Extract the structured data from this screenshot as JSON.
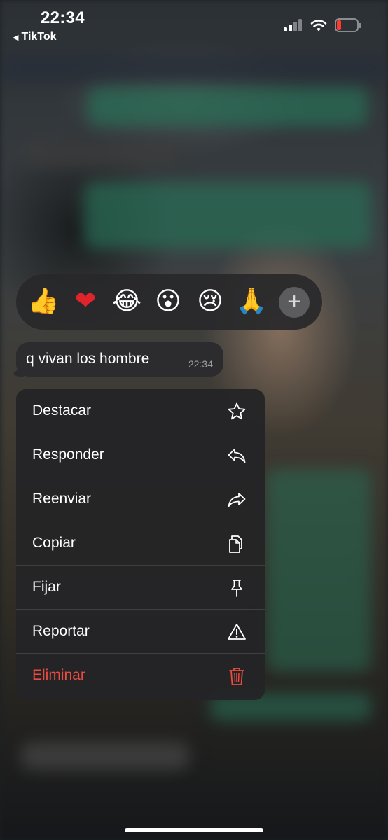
{
  "status_bar": {
    "time": "22:34",
    "back_app": "TikTok",
    "back_arrow": "◀",
    "battery_color": "#ff3b30"
  },
  "reactions": {
    "emojis": [
      "👍",
      "❤",
      "😂",
      "😮",
      "😢",
      "🙏"
    ],
    "emoji_names": [
      "thumbs-up",
      "heart",
      "tears-of-joy",
      "surprised",
      "crying",
      "folded-hands"
    ],
    "add_symbol": "+"
  },
  "message": {
    "text": "q vivan los hombre",
    "time": "22:34"
  },
  "menu": {
    "items": [
      {
        "label": "Destacar",
        "icon": "star-icon"
      },
      {
        "label": "Responder",
        "icon": "reply-icon"
      },
      {
        "label": "Reenviar",
        "icon": "forward-icon"
      },
      {
        "label": "Copiar",
        "icon": "copy-icon"
      },
      {
        "label": "Fijar",
        "icon": "pin-icon"
      },
      {
        "label": "Reportar",
        "icon": "warning-icon"
      },
      {
        "label": "Eliminar",
        "icon": "trash-icon",
        "color": "#eb4b40"
      }
    ]
  }
}
